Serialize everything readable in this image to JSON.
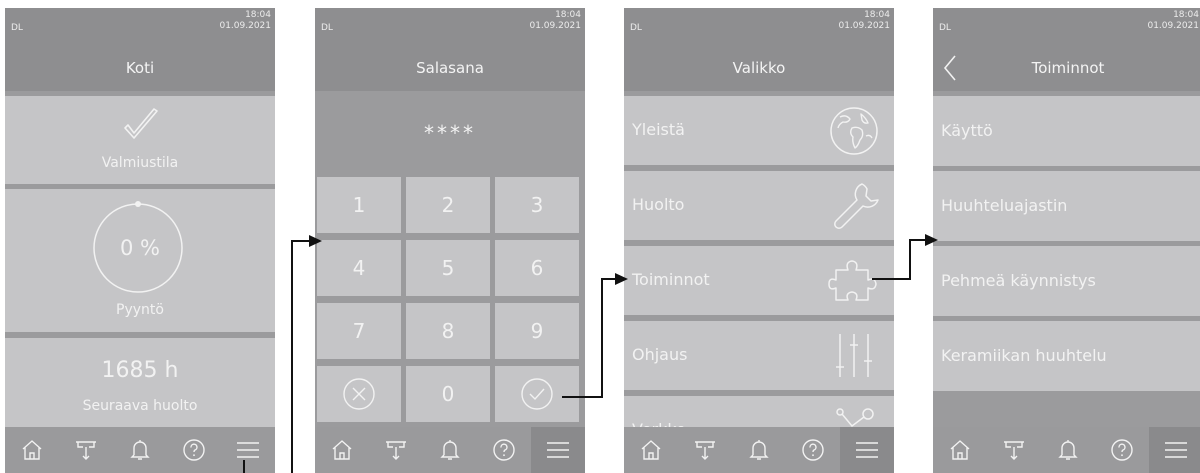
{
  "status": {
    "dl": "DL",
    "time": "18:04",
    "date": "01.09.2021"
  },
  "home": {
    "title": "Koti",
    "ready_label": "Valmiustila",
    "demand_value": "0 %",
    "demand_label": "Pyyntö",
    "service_value": "1685 h",
    "service_label": "Seuraava huolto"
  },
  "password": {
    "title": "Salasana",
    "entry": "****",
    "keys": [
      "1",
      "2",
      "3",
      "4",
      "5",
      "6",
      "7",
      "8",
      "9",
      "0"
    ]
  },
  "menu": {
    "title": "Valikko",
    "items": [
      {
        "label": "Yleistä",
        "icon": "globe-icon"
      },
      {
        "label": "Huolto",
        "icon": "wrench-icon"
      },
      {
        "label": "Toiminnot",
        "icon": "puzzle-icon"
      },
      {
        "label": "Ohjaus",
        "icon": "sliders-icon"
      },
      {
        "label": "Verkko",
        "icon": "network-icon"
      }
    ]
  },
  "functions": {
    "title": "Toiminnot",
    "items": [
      "Käyttö",
      "Huuhteluajastin",
      "Pehmeä käynnistys",
      "Keramiikan huuhtelu"
    ]
  },
  "nav_icons": [
    "home-icon",
    "drain-icon",
    "bell-icon",
    "help-icon",
    "menu-icon"
  ],
  "colors": {
    "panel": "#9b9b9d",
    "tile": "#c5c5c7",
    "header": "#8e8e90",
    "text": "#f4f4f4",
    "arrow": "#111111"
  }
}
